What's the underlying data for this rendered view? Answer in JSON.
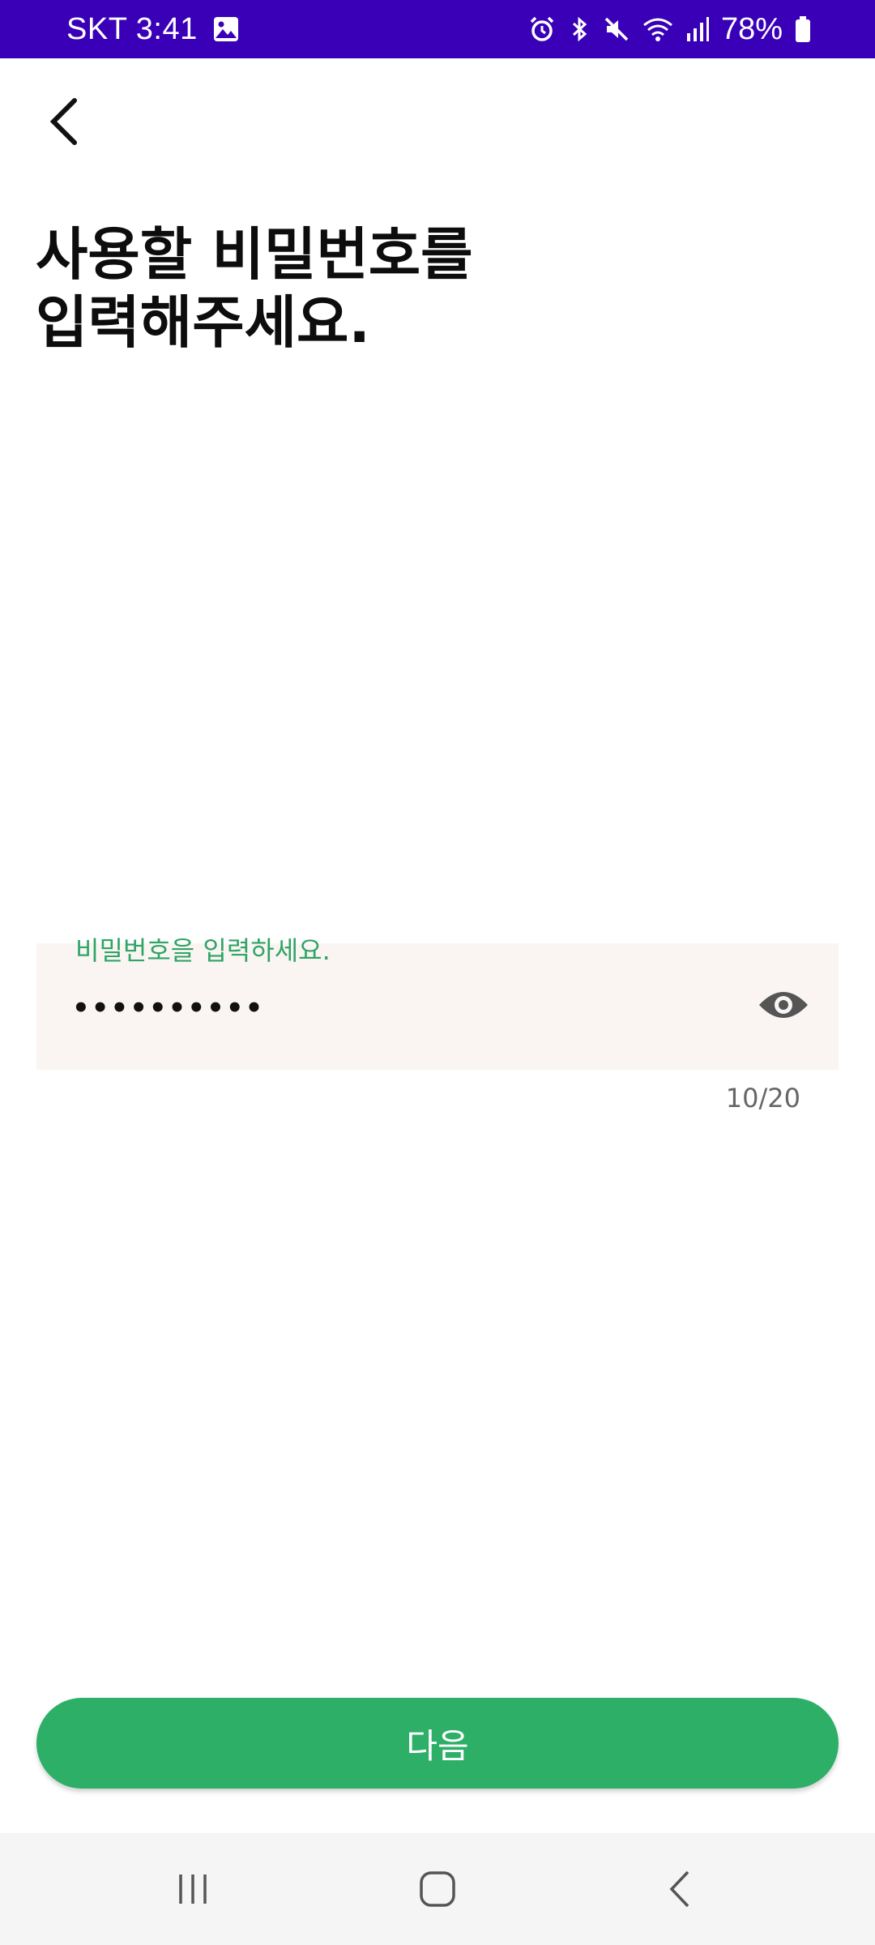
{
  "status_bar": {
    "carrier_time": "SKT 3:41",
    "battery_percent": "78%",
    "background_color": "#3a00b8",
    "icons": [
      "image-icon",
      "alarm-icon",
      "bluetooth-icon",
      "mute-icon",
      "wifi-icon",
      "signal-icon",
      "battery-icon"
    ]
  },
  "header": {
    "back_icon": "back-arrow-icon"
  },
  "main": {
    "title": "사용할 비밀번호를\n입력해주세요.",
    "password_field": {
      "label": "비밀번호을 입력하세요.",
      "value": "••••••••••",
      "toggle_icon": "eye-icon",
      "counter": "10/20",
      "label_color": "#2fa466"
    }
  },
  "footer": {
    "next_label": "다음",
    "accent_color": "#2daf68"
  },
  "nav_bar": {
    "icons": [
      "recent-apps-icon",
      "home-icon",
      "back-icon"
    ]
  }
}
